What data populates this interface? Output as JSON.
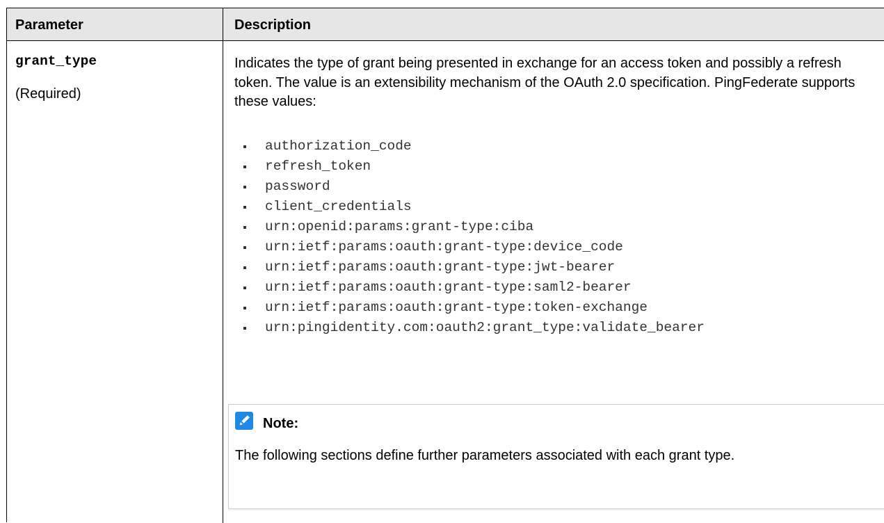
{
  "table": {
    "headers": {
      "parameter": "Parameter",
      "description": "Description"
    },
    "row": {
      "parameter_name": "grant_type",
      "requirement": "(Required)",
      "description": "Indicates the type of grant being presented in exchange for an access token and possibly a refresh token. The value is an extensibility mechanism of the OAuth 2.0 specification. PingFederate supports these values:",
      "values": [
        "authorization_code",
        "refresh_token",
        "password",
        "client_credentials",
        "urn:openid:params:grant-type:ciba",
        "urn:ietf:params:oauth:grant-type:device_code",
        "urn:ietf:params:oauth:grant-type:jwt-bearer",
        "urn:ietf:params:oauth:grant-type:saml2-bearer",
        "urn:ietf:params:oauth:grant-type:token-exchange",
        "urn:pingidentity.com:oauth2:grant_type:validate_bearer"
      ],
      "note": {
        "icon": "pencil-note-icon",
        "heading": "Note:",
        "text": "The following sections define further parameters associated with each grant type."
      }
    }
  },
  "colors": {
    "header_background": "#e6e6e6",
    "note_icon": "#1e88e5",
    "border": "#000000"
  }
}
